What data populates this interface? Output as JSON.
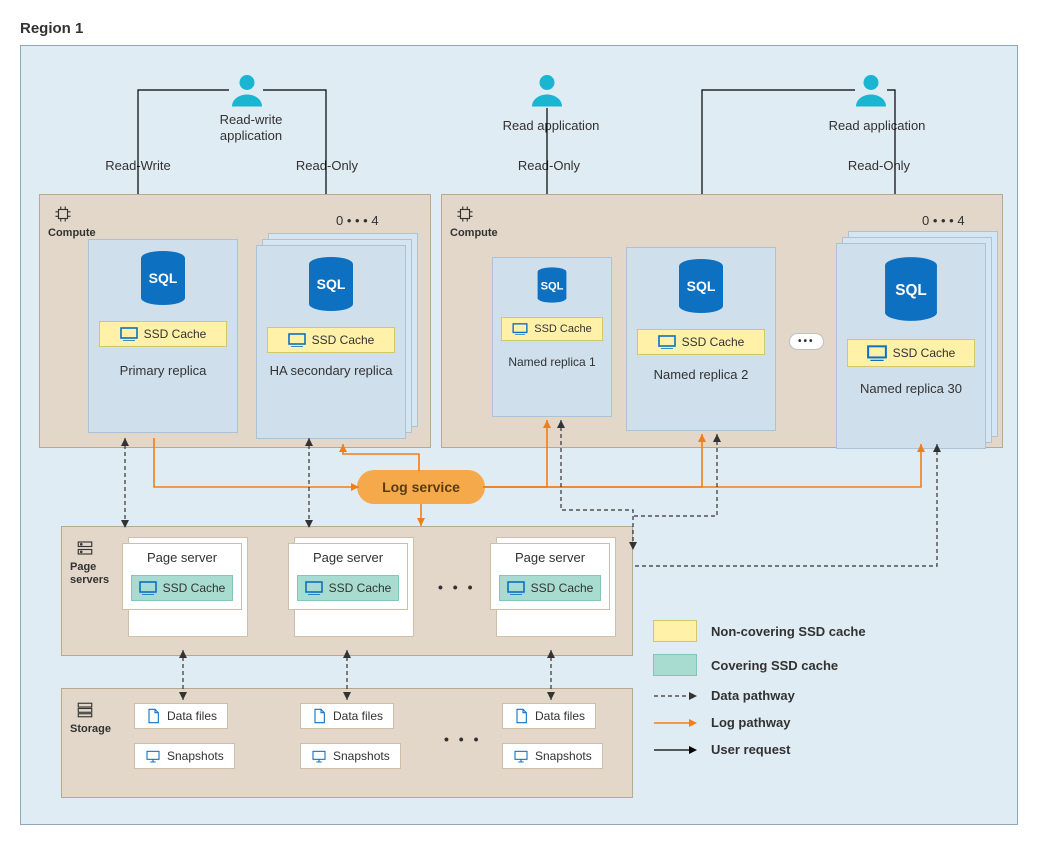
{
  "region_title": "Region 1",
  "apps": {
    "rw_app": "Read-write application",
    "read_app_1": "Read application",
    "read_app_2": "Read application"
  },
  "conn_labels": {
    "read_write": "Read-Write",
    "read_only": "Read-Only"
  },
  "panels": {
    "compute": "Compute",
    "page_servers": "Page servers",
    "storage": "Storage"
  },
  "scale": {
    "range": "0 • • • 4"
  },
  "ssd_cache_label": "SSD Cache",
  "replicas": {
    "primary": "Primary replica",
    "ha_secondary": "HA secondary replica",
    "named_1": "Named replica 1",
    "named_2": "Named replica 2",
    "named_30": "Named replica 30"
  },
  "sql_label": "SQL",
  "log_service": "Log service",
  "page_server": "Page server",
  "storage_items": {
    "data_files": "Data files",
    "snapshots": "Snapshots"
  },
  "legend": {
    "non_covering": "Non-covering SSD cache",
    "covering": "Covering SSD cache",
    "data_pathway": "Data pathway",
    "log_pathway": "Log pathway",
    "user_request": "User request"
  },
  "ellipsis_h": "• • •",
  "colors": {
    "azure_blue": "#0d70c1",
    "orange": "#f07e1a",
    "cyan": "#19b5d1"
  }
}
